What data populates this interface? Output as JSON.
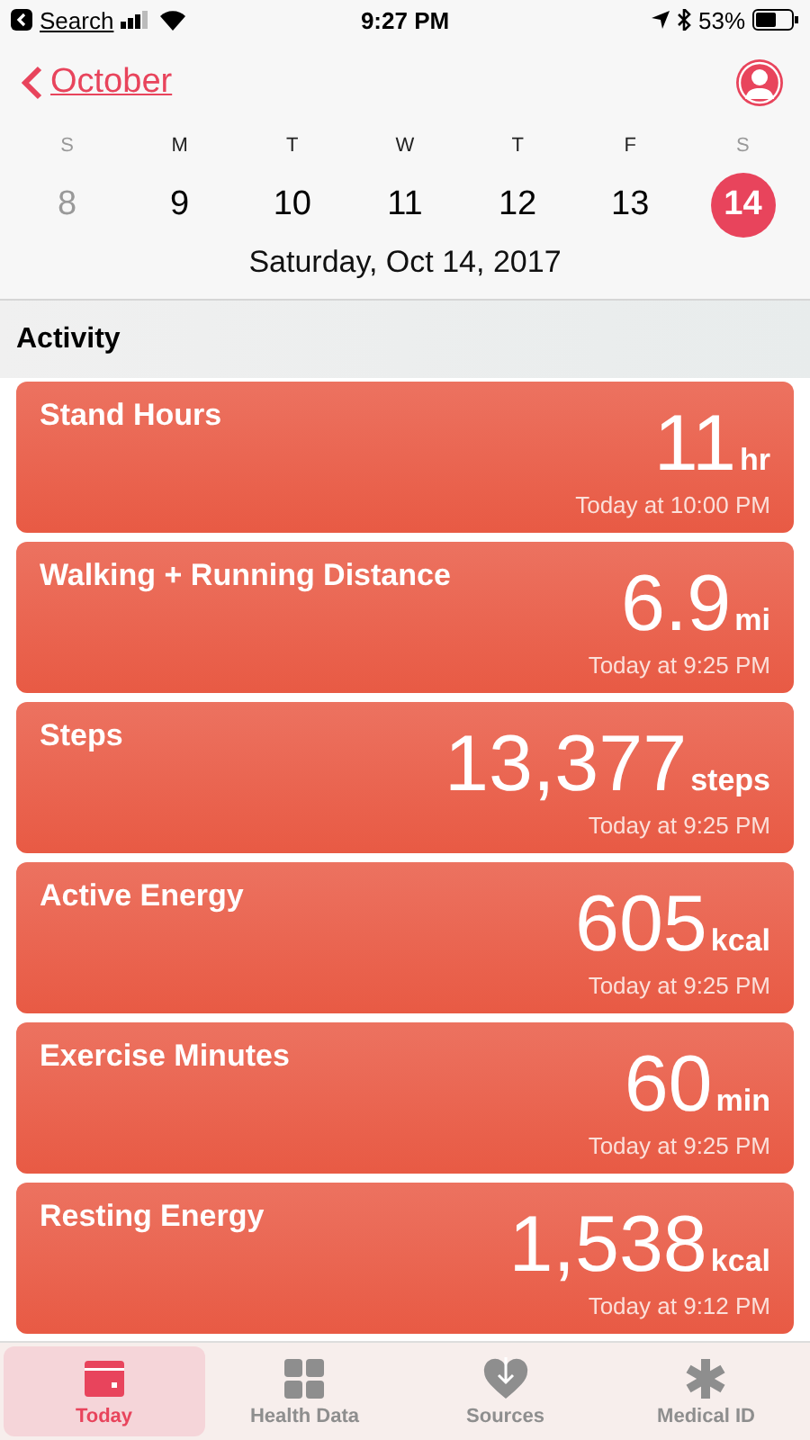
{
  "status_bar": {
    "back_label": "Search",
    "time": "9:27 PM",
    "battery": "53%"
  },
  "nav": {
    "back": "October"
  },
  "week": [
    {
      "letter": "S",
      "day": "8",
      "dimmed": true,
      "selected": false
    },
    {
      "letter": "M",
      "day": "9",
      "dimmed": false,
      "selected": false
    },
    {
      "letter": "T",
      "day": "10",
      "dimmed": false,
      "selected": false
    },
    {
      "letter": "W",
      "day": "11",
      "dimmed": false,
      "selected": false
    },
    {
      "letter": "T",
      "day": "12",
      "dimmed": false,
      "selected": false
    },
    {
      "letter": "F",
      "day": "13",
      "dimmed": false,
      "selected": false
    },
    {
      "letter": "S",
      "day": "14",
      "dimmed": false,
      "selected": true
    }
  ],
  "date_title": "Saturday, Oct 14, 2017",
  "section": "Activity",
  "cards": [
    {
      "title": "Stand Hours",
      "value": "11",
      "unit": "hr",
      "time": "Today at 10:00 PM"
    },
    {
      "title": "Walking + Running Distance",
      "value": "6.9",
      "unit": "mi",
      "time": "Today at 9:25 PM"
    },
    {
      "title": "Steps",
      "value": "13,377",
      "unit": "steps",
      "time": "Today at 9:25 PM"
    },
    {
      "title": "Active Energy",
      "value": "605",
      "unit": "kcal",
      "time": "Today at 9:25 PM"
    },
    {
      "title": "Exercise Minutes",
      "value": "60",
      "unit": "min",
      "time": "Today at 9:25 PM"
    },
    {
      "title": "Resting Energy",
      "value": "1,538",
      "unit": "kcal",
      "time": "Today at 9:12 PM"
    }
  ],
  "tabs": [
    {
      "label": "Today",
      "kind": "calendar",
      "selected": true
    },
    {
      "label": "Health Data",
      "kind": "grid",
      "selected": false
    },
    {
      "label": "Sources",
      "kind": "heart",
      "selected": false
    },
    {
      "label": "Medical ID",
      "kind": "asterisk",
      "selected": false
    }
  ]
}
